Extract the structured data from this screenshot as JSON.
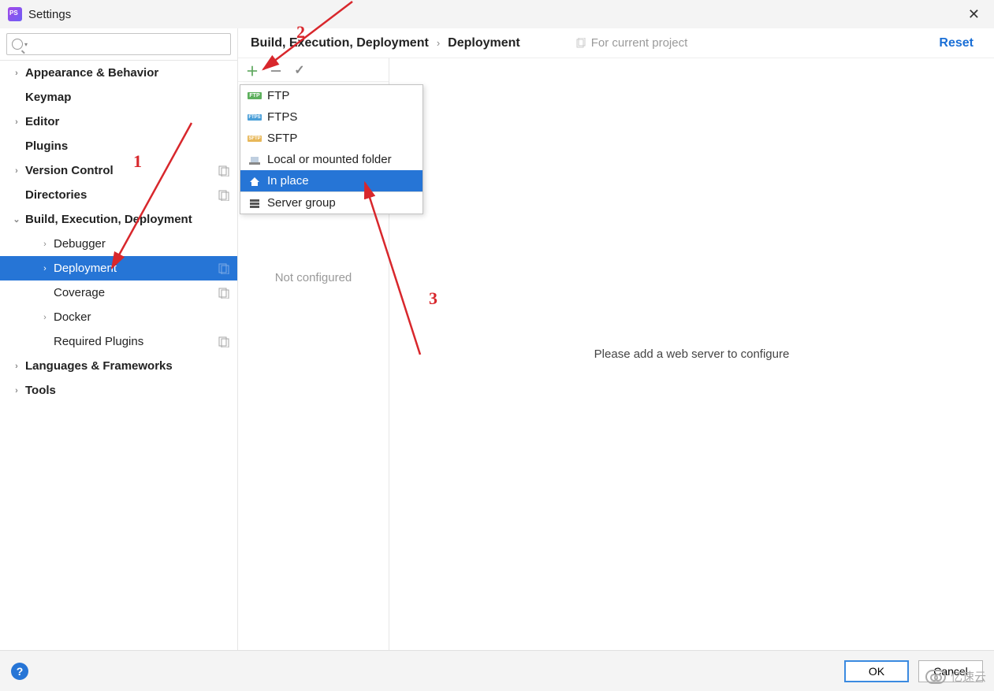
{
  "window": {
    "title": "Settings"
  },
  "breadcrumb": {
    "root": "Build, Execution, Deployment",
    "leaf": "Deployment"
  },
  "header": {
    "for_current_project": "For current project",
    "reset": "Reset"
  },
  "sidebar": {
    "items": [
      {
        "label": "Appearance & Behavior",
        "expandable": true,
        "bold": true
      },
      {
        "label": "Keymap",
        "bold": true
      },
      {
        "label": "Editor",
        "expandable": true,
        "bold": true
      },
      {
        "label": "Plugins",
        "bold": true
      },
      {
        "label": "Version Control",
        "expandable": true,
        "bold": true,
        "badge": true
      },
      {
        "label": "Directories",
        "bold": true,
        "badge": true
      },
      {
        "label": "Build, Execution, Deployment",
        "expandable": true,
        "expanded": true,
        "bold": true
      },
      {
        "label": "Debugger",
        "expandable": true,
        "sub": true
      },
      {
        "label": "Deployment",
        "expandable": true,
        "sub": true,
        "selected": true,
        "badge": true
      },
      {
        "label": "Coverage",
        "sub": true,
        "badge": true
      },
      {
        "label": "Docker",
        "expandable": true,
        "sub": true
      },
      {
        "label": "Required Plugins",
        "sub": true,
        "badge": true
      },
      {
        "label": "Languages & Frameworks",
        "expandable": true,
        "bold": true
      },
      {
        "label": "Tools",
        "expandable": true,
        "bold": true
      }
    ]
  },
  "list_panel": {
    "not_configured": "Not configured"
  },
  "detail": {
    "placeholder": "Please add a web server to configure"
  },
  "popup": {
    "items": [
      {
        "label": "FTP",
        "icon": "ftp"
      },
      {
        "label": "FTPS",
        "icon": "ftps"
      },
      {
        "label": "SFTP",
        "icon": "sftp"
      },
      {
        "label": "Local or mounted folder",
        "icon": "folder"
      },
      {
        "label": "In place",
        "icon": "home",
        "selected": true
      },
      {
        "label": "Server group",
        "icon": "server"
      }
    ]
  },
  "footer": {
    "ok": "OK",
    "cancel": "Cancel",
    "help": "?"
  },
  "annotations": {
    "n1": "1",
    "n2": "2",
    "n3": "3"
  },
  "watermark": "亿速云"
}
